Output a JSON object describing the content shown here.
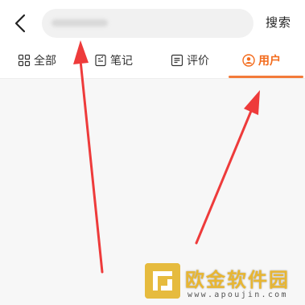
{
  "header": {
    "back_icon": "chevron-left-icon",
    "search_button_label": "搜索"
  },
  "tabs": [
    {
      "label": "全部",
      "icon": "grid-icon",
      "active": false
    },
    {
      "label": "笔记",
      "icon": "note-icon",
      "active": false
    },
    {
      "label": "评价",
      "icon": "comment-icon",
      "active": false
    },
    {
      "label": "用户",
      "icon": "user-icon",
      "active": true
    }
  ],
  "colors": {
    "accent": "#f36b1c",
    "annotation_arrow": "#ee3b3b",
    "watermark": "#e6bb3e"
  },
  "watermark": {
    "title": "欧金软件园",
    "url": "www.apoujin.com"
  }
}
